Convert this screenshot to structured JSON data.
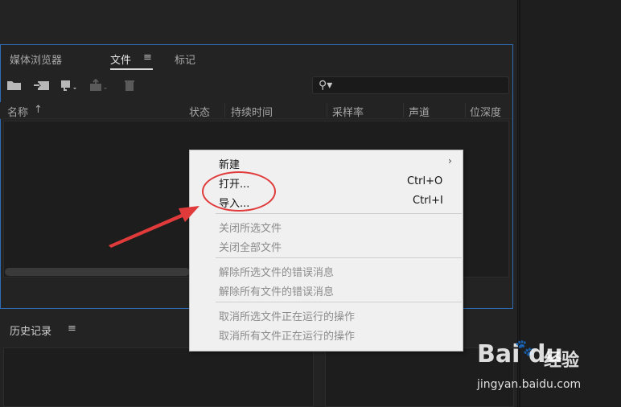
{
  "project_panel": {
    "tabs": [
      {
        "label": "媒体浏览器"
      },
      {
        "label": "文件"
      },
      {
        "label": "标记"
      }
    ],
    "active_tab_menu_glyph": "≡",
    "columns": [
      "名称",
      "状态",
      "持续时间",
      "采样率",
      "声道",
      "位深度"
    ],
    "sort_glyph": "↑"
  },
  "history_panel": {
    "title": "历史记录",
    "menu_glyph": "≡"
  },
  "context_menu": {
    "items": [
      {
        "label": "新建",
        "shortcut": "",
        "has_submenu": true,
        "submenu_glyph": "›"
      },
      {
        "label": "打开...",
        "shortcut": "Ctrl+O"
      },
      {
        "label": "导入...",
        "shortcut": "Ctrl+I"
      },
      {
        "label": "关闭所选文件",
        "disabled": true
      },
      {
        "label": "关闭全部文件",
        "disabled": true
      },
      {
        "label": "解除所选文件的错误消息",
        "disabled": true
      },
      {
        "label": "解除所有文件的错误消息",
        "disabled": true
      },
      {
        "label": "取消所选文件正在运行的操作",
        "disabled": true
      },
      {
        "label": "取消所有文件正在运行的操作",
        "disabled": true
      }
    ]
  },
  "annotations": {
    "highlight_color": "#e03a3a",
    "accent_border": "#2d6bb5"
  },
  "watermark": {
    "brand": "Bai",
    "paw": "🐾",
    "brand_suffix": "du",
    "site_cn": "经验",
    "url": "jingyan.baidu.com"
  }
}
